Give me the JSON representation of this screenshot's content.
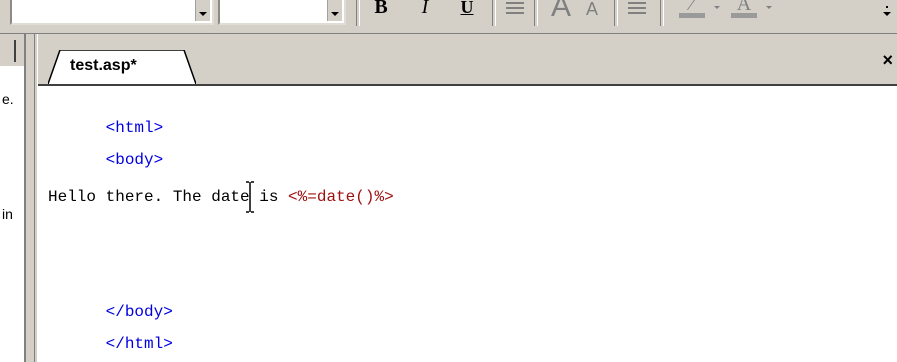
{
  "toolbar": {
    "bold": "B",
    "italic": "I",
    "underline": "U",
    "font_increase": "A",
    "font_decrease": "A"
  },
  "left_panel": {
    "fragment_1": "e.",
    "fragment_2": "in"
  },
  "editor": {
    "tab_title": "test.asp*",
    "close_symbol": "×",
    "lines": {
      "l1": "<html>",
      "l2": "<body>",
      "l3_text": "Hello there. The date",
      "l3_text2": " is ",
      "l3_asp": "<%=date()%>",
      "l4": "</body>",
      "l5": "</html>"
    }
  },
  "colors": {
    "tag": "#0000e0",
    "asp": "#a01010",
    "chrome": "#d4d0c8"
  }
}
